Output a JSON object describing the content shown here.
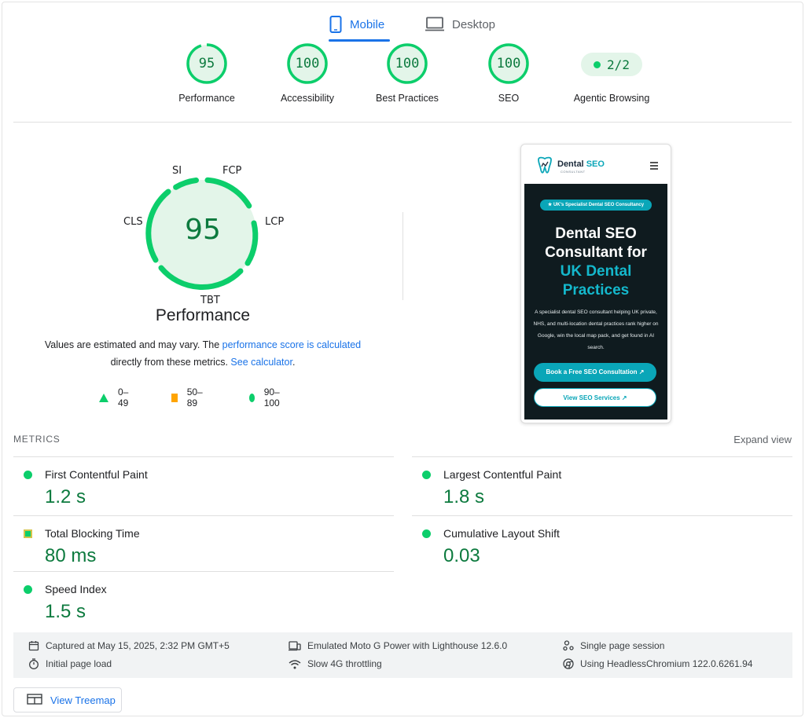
{
  "tabs": {
    "mobile": {
      "label": "Mobile",
      "icon": "smartphone-icon",
      "active": true
    },
    "desktop": {
      "label": "Desktop",
      "icon": "monitor-icon",
      "active": false
    }
  },
  "scores": [
    {
      "value": "95",
      "label": "Performance"
    },
    {
      "value": "100",
      "label": "Accessibility"
    },
    {
      "value": "100",
      "label": "Best Practices"
    },
    {
      "value": "100",
      "label": "SEO"
    }
  ],
  "agentic": {
    "value": "2/2",
    "label": "Agentic Browsing"
  },
  "gauge": {
    "score": "95",
    "title": "Performance",
    "segments": {
      "si": "SI",
      "fcp": "FCP",
      "lcp": "LCP",
      "tbt": "TBT",
      "cls": "CLS"
    },
    "pass_color": "#0cce6b"
  },
  "description": {
    "part1": "Values are estimated and may vary. The ",
    "link1": "performance score is calculated",
    "part2": "directly from these metrics. ",
    "link2": "See calculator",
    "part3": "."
  },
  "legend": [
    {
      "shape": "triangle",
      "range": "0–49"
    },
    {
      "shape": "square",
      "range": "50–89"
    },
    {
      "shape": "circle",
      "range": "90–100"
    }
  ],
  "screenshot": {
    "logo_main": "Dental",
    "logo_accent": "SEO",
    "logo_sub": "CONSULTANT",
    "badge": "★ UK's Specialist Dental SEO Consultancy",
    "hero_line1": "Dental SEO",
    "hero_line2": "Consultant for",
    "hero_line3": "UK Dental",
    "hero_line4": "Practices",
    "paragraph": "A specialist dental SEO consultant helping UK private, NHS, and multi-location dental practices rank higher on Google, win the local map pack, and get found in AI search.",
    "cta_primary": "Book a Free SEO Consultation ↗",
    "cta_secondary": "View SEO Services ↗"
  },
  "metrics": {
    "title": "METRICS",
    "expand": "Expand view",
    "fcp": {
      "name": "First Contentful Paint",
      "value": "1.2 s"
    },
    "lcp": {
      "name": "Largest Contentful Paint",
      "value": "1.8 s"
    },
    "tbt": {
      "name": "Total Blocking Time",
      "value": "80 ms"
    },
    "cls": {
      "name": "Cumulative Layout Shift",
      "value": "0.03"
    },
    "si": {
      "name": "Speed Index",
      "value": "1.5 s"
    }
  },
  "info": {
    "captured": "Captured at May 15, 2025, 2:32 PM GMT+5",
    "emulated": "Emulated Moto G Power with Lighthouse 12.6.0",
    "session": "Single page session",
    "initial": "Initial page load",
    "throttling": "Slow 4G throttling",
    "browser": "Using HeadlessChromium 122.0.6261.94"
  },
  "treemap": {
    "label": "View Treemap"
  },
  "colors": {
    "pass": "#0cce6b",
    "pass_text": "#0c7a3e",
    "average": "#ffa400",
    "link": "#1a73e8",
    "brand_teal": "#0aa6b8"
  }
}
